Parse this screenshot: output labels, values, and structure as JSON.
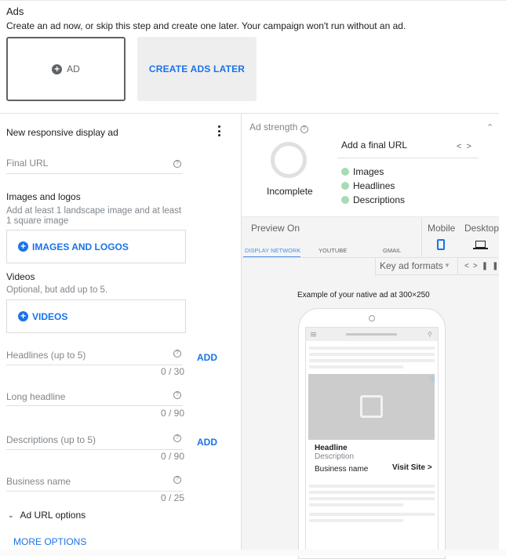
{
  "ads_section": {
    "title": "Ads",
    "description": "Create an ad now, or skip this step and create one later. Your campaign won't run without an ad.",
    "add_ad_label": "AD",
    "create_later_label": "CREATE ADS LATER"
  },
  "ad_form": {
    "title": "New responsive display ad",
    "more_icon": "kebab-vertical-icon",
    "final_url": {
      "label": "Final URL",
      "value": ""
    },
    "images": {
      "heading": "Images and logos",
      "hint": "Add at least 1 landscape image and at least 1 square image",
      "button_label": "IMAGES AND LOGOS"
    },
    "videos": {
      "heading": "Videos",
      "hint": "Optional, but add up to 5.",
      "button_label": "VIDEOS"
    },
    "headlines": {
      "label": "Headlines (up to 5)",
      "counter": "0 / 30",
      "add_label": "ADD"
    },
    "long_headline": {
      "label": "Long headline",
      "counter": "0 / 90"
    },
    "descriptions": {
      "label": "Descriptions (up to 5)",
      "counter": "0 / 90",
      "add_label": "ADD"
    },
    "business_name": {
      "label": "Business name",
      "counter": "0 / 25"
    },
    "url_options_label": "Ad URL options",
    "more_options_label": "MORE OPTIONS"
  },
  "ad_strength": {
    "title": "Ad strength",
    "status": "Incomplete",
    "progress": 0,
    "tip": "Add a final URL",
    "checklist": [
      "Images",
      "Headlines",
      "Descriptions"
    ],
    "check_color": "#a8dab5"
  },
  "preview": {
    "title": "Preview On",
    "tabs": [
      {
        "label": "DISPLAY NETWORK",
        "active": true
      },
      {
        "label": "YOUTUBE",
        "active": false
      },
      {
        "label": "GMAIL",
        "active": false
      }
    ],
    "devices": [
      {
        "label": "Mobile",
        "icon": "mobile-phone-icon",
        "active": true
      },
      {
        "label": "Desktop",
        "icon": "laptop-icon",
        "active": false
      }
    ],
    "format_select": "Key ad formats",
    "example_caption": "Example of your native ad at 300×250",
    "sample_ad": {
      "headline": "Headline",
      "description": "Description",
      "business_name": "Business name",
      "cta": "Visit Site"
    }
  },
  "colors": {
    "accent": "#1a73e8",
    "tab_active": "#4a90e2"
  }
}
